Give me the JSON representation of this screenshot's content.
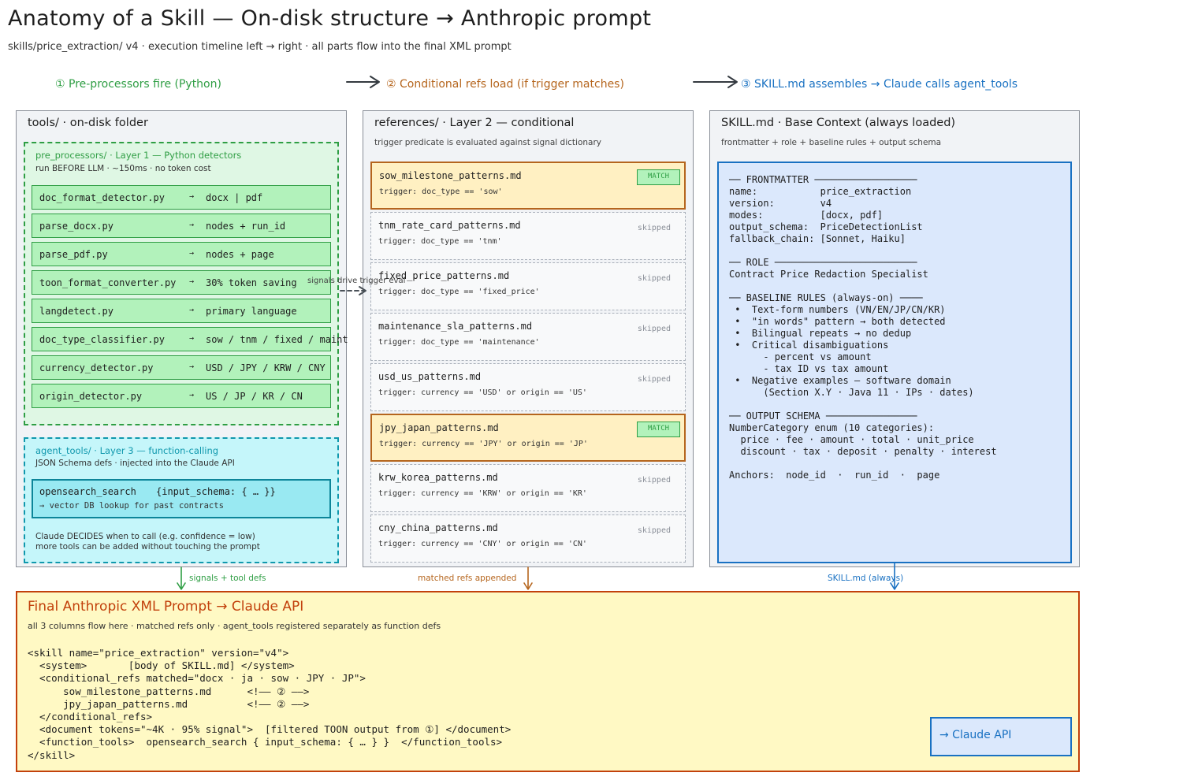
{
  "header": {
    "title": "Anatomy of a Skill — On-disk structure → Anthropic prompt",
    "subtitle": "skills/price_extraction/ v4  ·  execution timeline left → right · all parts flow into the final XML prompt"
  },
  "phases": [
    {
      "label": "①  Pre-processors fire  (Python)",
      "color": "#2f9e44"
    },
    {
      "label": "②  Conditional refs load  (if trigger matches)",
      "color": "#b5651d"
    },
    {
      "label": "③  SKILL.md assembles  →  Claude calls agent_tools",
      "color": "#1971c2"
    }
  ],
  "tools": {
    "title": "tools/  ·  on-disk folder",
    "pre_processors": {
      "title": "pre_processors/  ·  Layer 1 — Python detectors",
      "subtitle": "run BEFORE LLM  ·  ~150ms  ·  no token cost",
      "items": [
        {
          "name": "doc_format_detector.py",
          "output": "docx | pdf"
        },
        {
          "name": "parse_docx.py",
          "output": "nodes + run_id"
        },
        {
          "name": "parse_pdf.py",
          "output": "nodes + page"
        },
        {
          "name": "toon_format_converter.py",
          "output": "30% token saving"
        },
        {
          "name": "langdetect.py",
          "output": "primary language"
        },
        {
          "name": "doc_type_classifier.py",
          "output": "sow / tnm / fixed / maint"
        },
        {
          "name": "currency_detector.py",
          "output": "USD / JPY / KRW / CNY"
        },
        {
          "name": "origin_detector.py",
          "output": "US / JP / KR / CN"
        }
      ]
    },
    "agent_tools": {
      "title": "agent_tools/  ·  Layer 3 — function-calling",
      "subtitle": "JSON Schema defs · injected into the Claude API",
      "tool_name": "opensearch_search",
      "tool_schema": "{input_schema: { … }}",
      "tool_desc": "→ vector DB lookup for past contracts",
      "note1": "Claude DECIDES when to call (e.g. confidence = low)",
      "note2": "more tools can be added without touching the prompt"
    }
  },
  "references": {
    "title": "references/  ·  Layer 2 — conditional",
    "subtitle": "trigger predicate is evaluated against signal dictionary",
    "match_label": "MATCH",
    "skip_label": "skipped",
    "items": [
      {
        "name": "sow_milestone_patterns.md",
        "trigger": "trigger: doc_type == 'sow'",
        "status": "match"
      },
      {
        "name": "tnm_rate_card_patterns.md",
        "trigger": "trigger: doc_type == 'tnm'",
        "status": "skip"
      },
      {
        "name": "fixed_price_patterns.md",
        "trigger": "trigger: doc_type == 'fixed_price'",
        "status": "skip"
      },
      {
        "name": "maintenance_sla_patterns.md",
        "trigger": "trigger: doc_type == 'maintenance'",
        "status": "skip"
      },
      {
        "name": "usd_us_patterns.md",
        "trigger": "trigger: currency == 'USD' or origin == 'US'",
        "status": "skip"
      },
      {
        "name": "jpy_japan_patterns.md",
        "trigger": "trigger: currency == 'JPY' or origin == 'JP'",
        "status": "match"
      },
      {
        "name": "krw_korea_patterns.md",
        "trigger": "trigger: currency == 'KRW' or origin == 'KR'",
        "status": "skip"
      },
      {
        "name": "cny_china_patterns.md",
        "trigger": "trigger: currency == 'CNY' or origin == 'CN'",
        "status": "skip"
      }
    ]
  },
  "skill": {
    "title": "SKILL.md  ·  Base Context (always loaded)",
    "subtitle": "frontmatter + role + baseline rules + output schema",
    "body": "── FRONTMATTER ──────────────────\nname:           price_extraction\nversion:        v4\nmodes:          [docx, pdf]\noutput_schema:  PriceDetectionList\nfallback_chain: [Sonnet, Haiku]\n\n── ROLE ─────────────────────────\nContract Price Redaction Specialist\n\n── BASELINE RULES (always-on) ────\n •  Text-form numbers (VN/EN/JP/CN/KR)\n •  \"in words\" pattern → both detected\n •  Bilingual repeats → no dedup\n •  Critical disambiguations\n      - percent vs amount\n      - tax ID vs tax amount\n •  Negative examples — software domain\n      (Section X.Y · Java 11 · IPs · dates)\n\n── OUTPUT SCHEMA ────────────────\nNumberCategory enum (10 categories):\n  price · fee · amount · total · unit_price\n  discount · tax · deposit · penalty · interest\n\nAnchors:  node_id  ·  run_id  ·  page"
  },
  "connectors": {
    "signals": "signals + tool defs",
    "matched": "matched refs appended",
    "skill": "SKILL.md (always)",
    "drive": "signals drive trigger eval"
  },
  "final": {
    "title": "Final Anthropic XML Prompt  →  Claude API",
    "subtitle": "all 3 columns flow here · matched refs only · agent_tools registered separately as function defs",
    "code": "<skill name=\"price_extraction\" version=\"v4\">\n  <system>       [body of SKILL.md] </system>\n  <conditional_refs matched=\"docx · ja · sow · JPY · JP\">\n      sow_milestone_patterns.md      <!—— ② ——>\n      jpy_japan_patterns.md          <!—— ② ——>\n  </conditional_refs>\n  <document tokens=\"~4K · 95% signal\">  [filtered TOON output from ①] </document>\n  <function_tools>  opensearch_search { input_schema: { … } }  </function_tools>\n</skill>",
    "api_label": "→  Claude API"
  }
}
